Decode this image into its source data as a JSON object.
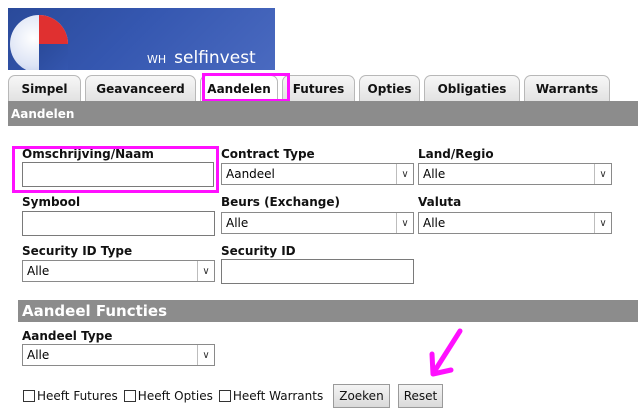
{
  "logo": {
    "wh": "WH",
    "brand": "selfinvest"
  },
  "tabs": [
    {
      "label": "Simpel"
    },
    {
      "label": "Geavanceerd"
    },
    {
      "label": "Aandelen"
    },
    {
      "label": "Futures"
    },
    {
      "label": "Opties"
    },
    {
      "label": "Obligaties"
    },
    {
      "label": "Warrants"
    }
  ],
  "section_title": "Aandelen",
  "form": {
    "omschrijving_label": "Omschrijving/Naam",
    "omschrijving_value": "",
    "contract_type_label": "Contract Type",
    "contract_type_value": "Aandeel",
    "land_label": "Land/Regio",
    "land_value": "Alle",
    "symbool_label": "Symbool",
    "symbool_value": "",
    "beurs_label": "Beurs (Exchange)",
    "beurs_value": "Alle",
    "valuta_label": "Valuta",
    "valuta_value": "Alle",
    "security_id_type_label": "Security ID Type",
    "security_id_type_value": "Alle",
    "security_id_label": "Security ID",
    "security_id_value": ""
  },
  "functies": {
    "title": "Aandeel Functies",
    "aandeel_type_label": "Aandeel Type",
    "aandeel_type_value": "Alle"
  },
  "options": {
    "futures_label": "Heeft Futures",
    "opties_label": "Heeft Opties",
    "warrants_label": "Heeft Warrants"
  },
  "buttons": {
    "zoeken": "Zoeken",
    "reset": "Reset"
  },
  "colors": {
    "highlight": "#ff10ff",
    "section_bar": "#8c8c8c",
    "logo_blue": "#3557b0",
    "logo_red": "#e03030"
  }
}
